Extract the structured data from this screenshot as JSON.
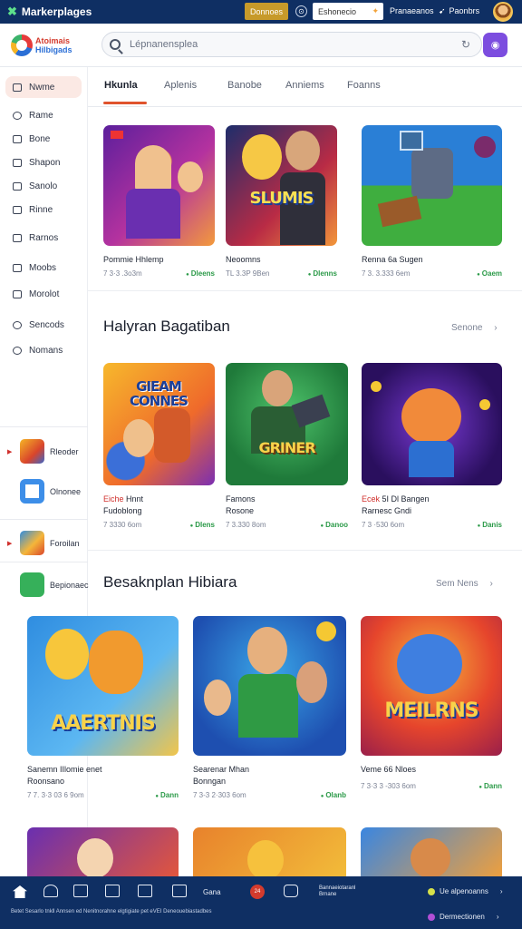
{
  "topbar": {
    "brand": "Markerplages",
    "gold_button": "Donnoes",
    "field_text": "Eshonecio",
    "link1": "Pranaeanos",
    "link2": "Paonbrs"
  },
  "header": {
    "logo_line1": "Atoimais",
    "logo_line2": "Hilbigads",
    "search_placeholder": "Lépnanensplea"
  },
  "sidebar": {
    "items": [
      {
        "label": "Nwme"
      },
      {
        "label": "Rame"
      },
      {
        "label": "Bone"
      },
      {
        "label": "Shapon"
      },
      {
        "label": "Sanolo"
      },
      {
        "label": "Rinne"
      },
      {
        "label": "Rarnos"
      },
      {
        "label": "Moobs"
      },
      {
        "label": "Morolot"
      },
      {
        "label": "Sencods"
      },
      {
        "label": "Nomans"
      }
    ],
    "apps": [
      {
        "label": "Rleoder"
      },
      {
        "label": "Olnonee"
      },
      {
        "label": "Foroilan"
      },
      {
        "label": "Bepionaec"
      }
    ]
  },
  "tabs": [
    "Hkunla",
    "Aplenis",
    "Banobe",
    "Anniems",
    "Foanns"
  ],
  "section1": {
    "cards": [
      {
        "title": "Pommie Hhlemp",
        "subtitle": "",
        "meta": "7 3·3 .3o3m",
        "price": "Dleens",
        "art_text": ""
      },
      {
        "title": "Neoomns",
        "subtitle": "",
        "meta": "TL 3.3P 9Ben",
        "price": "Dlenns",
        "art_text": "SLUMIS"
      },
      {
        "title": "Renna 6a Sugen",
        "subtitle": "",
        "meta": "7 3. 3.333 6em",
        "price": "Oaem",
        "art_text": ""
      }
    ]
  },
  "section2": {
    "title": "Halyran Bagatiban",
    "see_all": "Senone",
    "cards": [
      {
        "title_red": "Eiche",
        "title": "Hnnt",
        "subtitle": "Fudoblong",
        "meta": "7 3330 6om",
        "price": "Dlens",
        "art_text": "GIEAM CONNES"
      },
      {
        "title_red": "",
        "title": "Famons",
        "subtitle": "Rosone",
        "meta": "7 3.330 8om",
        "price": "Danoo",
        "art_text": "GRINER"
      },
      {
        "title_red": "Ecek",
        "title": "5I Dl Bangen",
        "subtitle": "Rarnesc Gndi",
        "meta": "7 3 ·530 6om",
        "price": "Danis",
        "art_text": ""
      }
    ]
  },
  "section3": {
    "title": "Besaknplan Hibiara",
    "see_all": "Sem Nens",
    "cards": [
      {
        "title": "Sanemn IIlomie enet",
        "subtitle": "Roonsano",
        "meta": "7 7. 3·3 03 6 9om",
        "price": "Dann",
        "art_text": "AAERTNIS"
      },
      {
        "title": "Searenar Mhan",
        "subtitle": "Bonngan",
        "meta": "7 3-3 2·303 6om",
        "price": "Olanb",
        "art_text": ""
      },
      {
        "title": "Veme 66 Nloes",
        "subtitle": "",
        "meta": "7 3·3 3 -303 6om",
        "price": "Dann",
        "art_text": "MEILRNS"
      }
    ]
  },
  "bottombar": {
    "item_text1": "Gana",
    "item_badge": "24",
    "item_text2": "Bannaeiotaranl Brnane",
    "right_top": "Ue alpenoanns",
    "right_bottom": "Dermectionen",
    "legal": "Betet Sesarlo tnkll Annsen ed Nenitnorahne elgtigiate pet eVEI Deneouebiastadbes"
  },
  "colors": {
    "navy": "#0f2f63",
    "accent_orange": "#e0532d",
    "purple": "#7c4ddf",
    "price_green": "#2b9a48"
  }
}
